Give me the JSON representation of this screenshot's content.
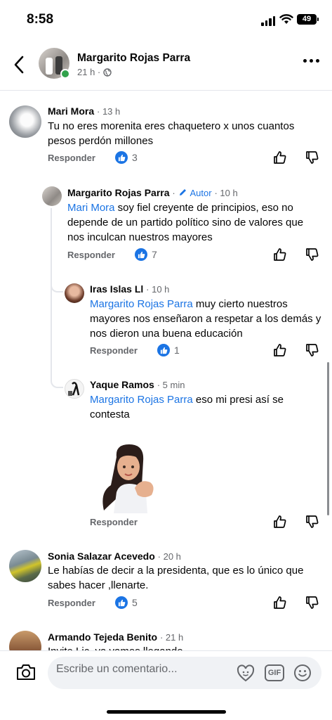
{
  "status_bar": {
    "time": "8:58",
    "battery": "49"
  },
  "post_header": {
    "name": "Margarito Rojas Parra",
    "time": "21 h ·"
  },
  "comments": [
    {
      "name": "Mari Mora",
      "time": "· 13 h",
      "text": "Tu no eres morenita eres chaquetero x unos cuantos pesos perdón millones",
      "reply": "Responder",
      "likes": "3"
    },
    {
      "name": "Margarito Rojas Parra",
      "author": "Autor",
      "time": "· 10 h",
      "mention": "Mari Mora",
      "text": " soy fiel creyente de principios, eso no depende de un partido político sino de valores que nos inculcan nuestros mayores",
      "reply": "Responder",
      "likes": "7"
    },
    {
      "name": "Iras Islas Ll",
      "time": "· 10 h",
      "mention": "Margarito Rojas Parra",
      "text": " muy cierto nuestros mayores nos enseñaron a respetar a los demás y nos dieron una buena educación",
      "reply": "Responder",
      "likes": "1"
    },
    {
      "name": "Yaque Ramos",
      "time": "· 5 min",
      "mention": "Margarito Rojas Parra",
      "text": " eso mi presi así se contesta",
      "reply": "Responder"
    },
    {
      "name": "Sonia Salazar Acevedo",
      "time": "· 20 h",
      "text": "Le habías de decir a la presidenta,  que es  lo único que sabes hacer ,llenarte.",
      "reply": "Responder",
      "likes": "5"
    },
    {
      "name": "Armando Tejeda Benito",
      "time": "· 21 h",
      "text": "Invite Lic. ya vamos llegando"
    }
  ],
  "composer": {
    "placeholder": "Escribe un comentario...",
    "gif_label": "GIF"
  },
  "colors": {
    "accent": "#1b74e4",
    "secondary_text": "#65676b",
    "online": "#31a24c"
  }
}
